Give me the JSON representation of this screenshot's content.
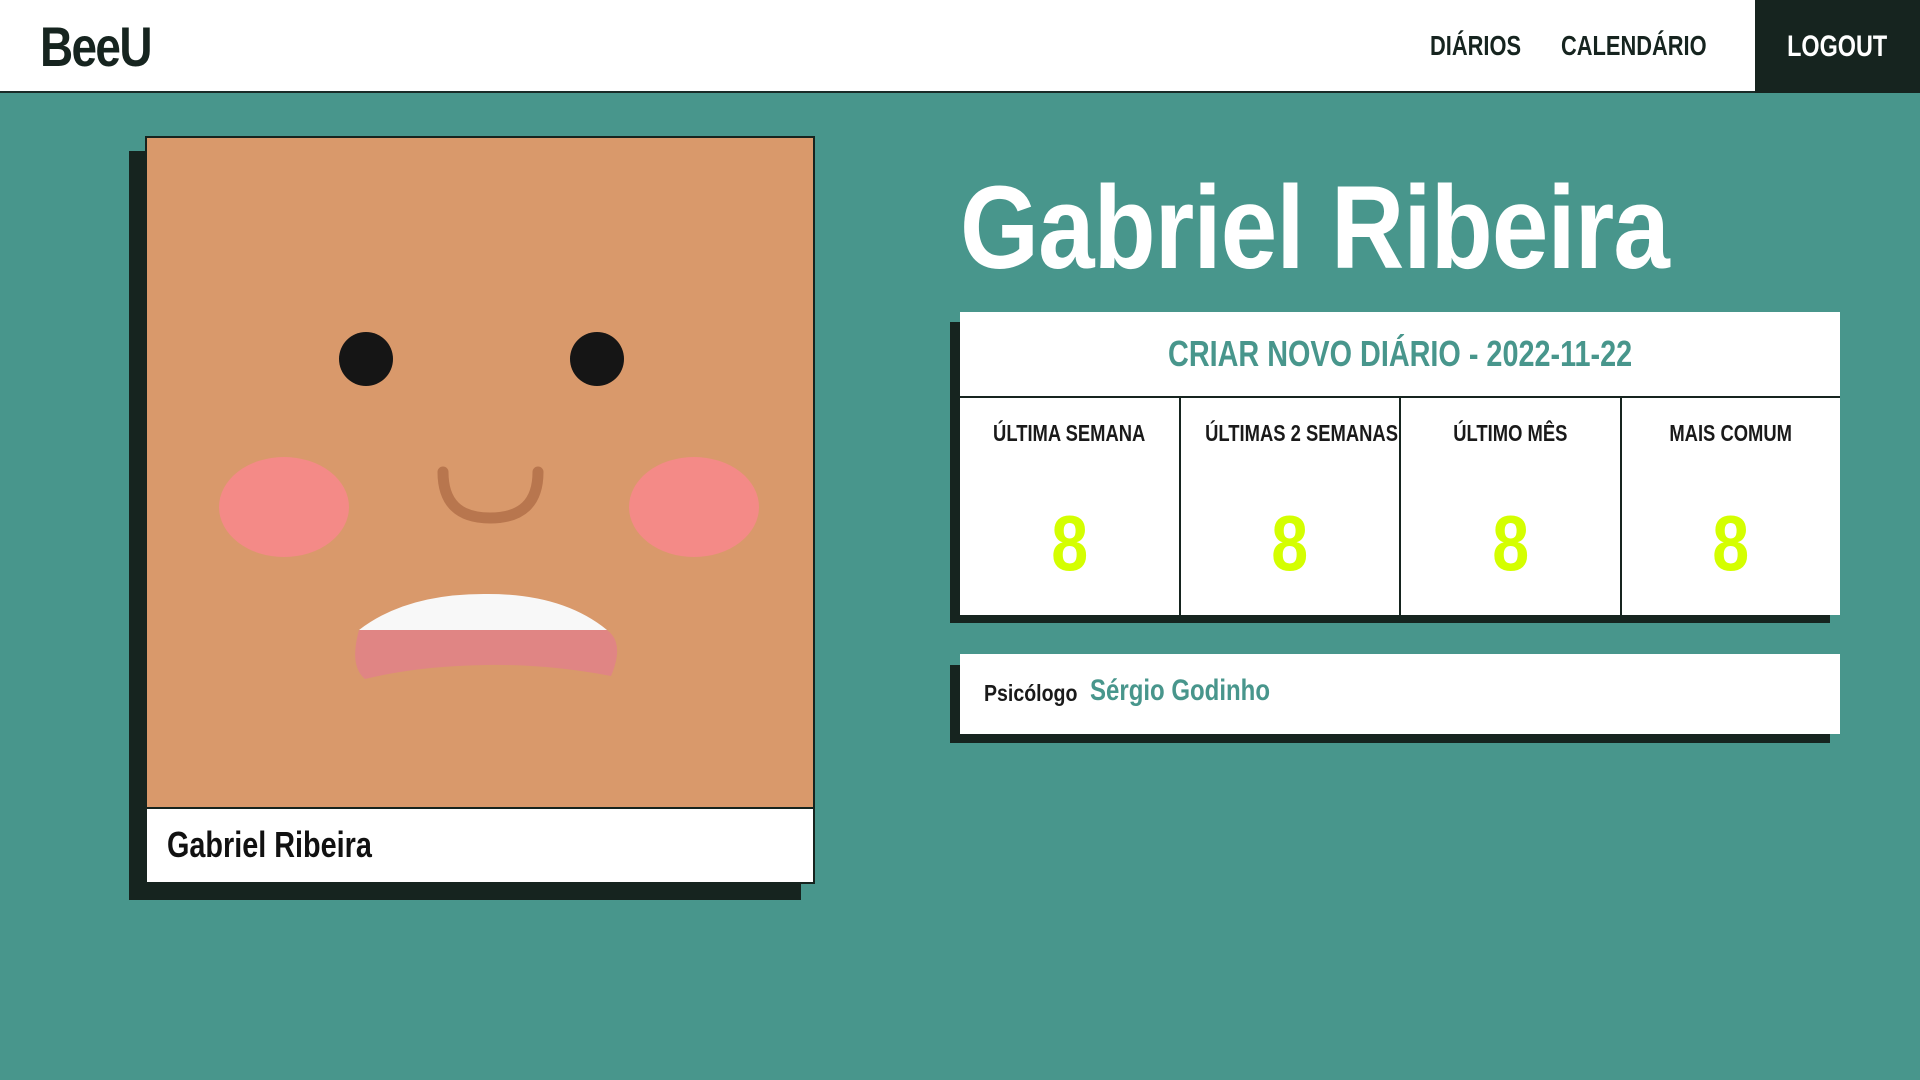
{
  "app": {
    "logo": "BeeU"
  },
  "nav": {
    "items": [
      {
        "label": "DIÁRIOS"
      },
      {
        "label": "CALENDÁRIO"
      }
    ],
    "logout_label": "LOGOUT"
  },
  "profile": {
    "avatar_caption": "Gabriel Ribeira",
    "name": "Gabriel Ribeira"
  },
  "diary": {
    "create_label": "CRIAR NOVO DIÁRIO - 2022-11-22",
    "stats": [
      {
        "label": "ÚLTIMA SEMANA",
        "value": "8"
      },
      {
        "label": "ÚLTIMAS 2 SEMANAS",
        "value": "8"
      },
      {
        "label": "ÚLTIMO MÊS",
        "value": "8"
      },
      {
        "label": "MAIS COMUM",
        "value": "8"
      }
    ]
  },
  "psychologist": {
    "label": "Psicólogo",
    "name": "Sérgio Godinho"
  },
  "colors": {
    "background": "#48968c",
    "dark": "#16241f",
    "accent": "#48968c",
    "stat_value": "#d4ff00",
    "face_skin": "#d9996b",
    "cheek": "#f48a87"
  }
}
